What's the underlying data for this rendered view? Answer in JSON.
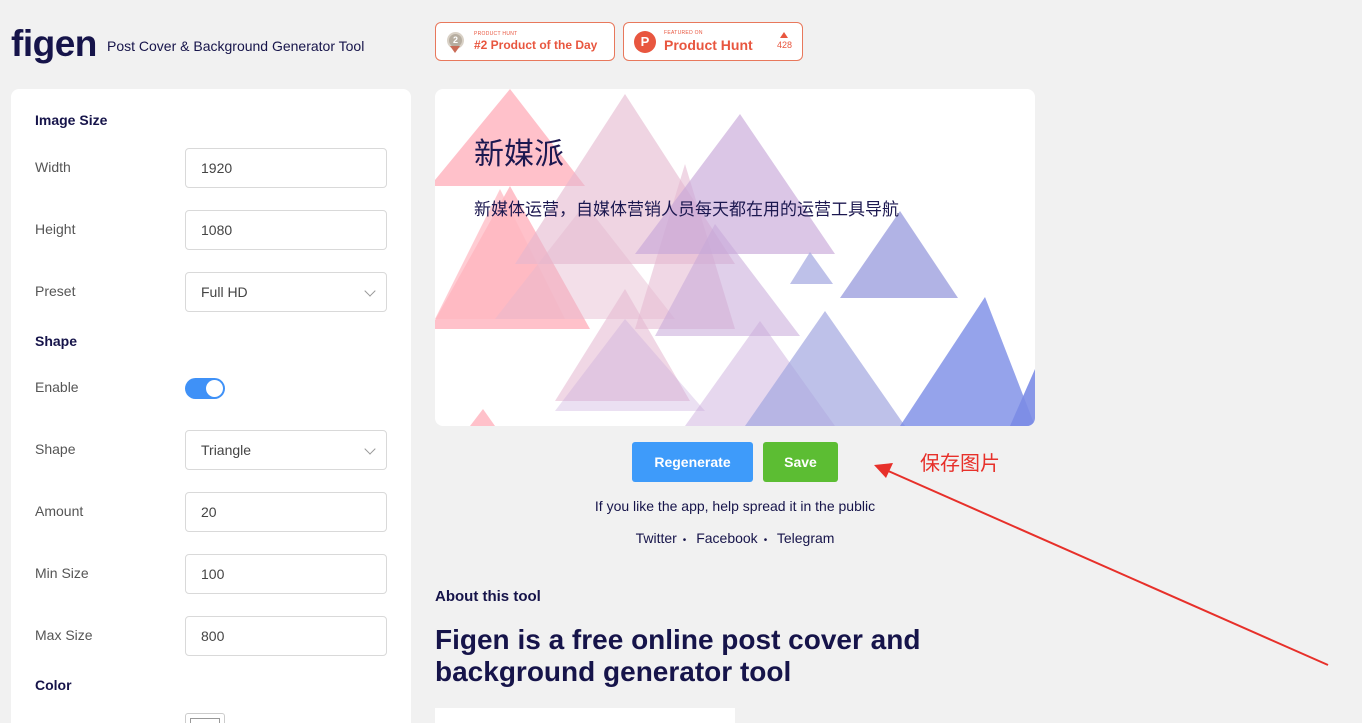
{
  "header": {
    "logo": "figen",
    "tagline": "Post Cover & Background Generator Tool",
    "badge_day": {
      "small": "PRODUCT HUNT",
      "rank": "2",
      "label": "#2 Product of the Day"
    },
    "badge_featured": {
      "small": "FEATURED ON",
      "label": "Product Hunt",
      "votes": "428",
      "icon_letter": "P"
    },
    "accent_color": "#e8563f"
  },
  "sidebar": {
    "image_size_title": "Image Size",
    "width_label": "Width",
    "width_value": "1920",
    "height_label": "Height",
    "height_value": "1080",
    "preset_label": "Preset",
    "preset_value": "Full HD",
    "shape_section_title": "Shape",
    "enable_label": "Enable",
    "enable_on": true,
    "shape_label": "Shape",
    "shape_value": "Triangle",
    "amount_label": "Amount",
    "amount_value": "20",
    "min_size_label": "Min Size",
    "min_size_value": "100",
    "max_size_label": "Max Size",
    "max_size_value": "800",
    "color_title": "Color"
  },
  "preview": {
    "title": "新媒派",
    "subtitle": "新媒体运营，自媒体营销人员每天都在用的运营工具导航",
    "shape_colors": [
      "#ffb6c1",
      "#e4b7cf",
      "#c7a7d9",
      "#a3a6e0",
      "#7b8ce6"
    ]
  },
  "actions": {
    "regenerate_label": "Regenerate",
    "save_label": "Save",
    "regenerate_color": "#3e9bfa",
    "save_color": "#5cbd33"
  },
  "annotation": {
    "text": "保存图片",
    "color": "#e7302a"
  },
  "share": {
    "prompt": "If you like the app, help spread it in the public",
    "links": [
      "Twitter",
      "Facebook",
      "Telegram"
    ]
  },
  "about": {
    "title": "About this tool",
    "headline": "Figen is a free online post cover and background generator tool"
  }
}
